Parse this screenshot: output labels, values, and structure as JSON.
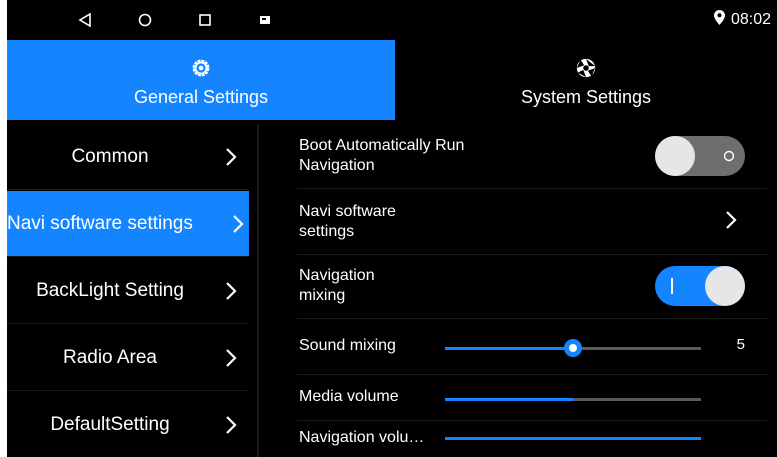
{
  "status_bar": {
    "icons": [
      "back-icon",
      "home-icon",
      "recents-icon",
      "screenshot-icon"
    ],
    "location_icon": "location-pin-icon",
    "time": "08:02"
  },
  "tabs": [
    {
      "label": "General Settings",
      "icon": "gear-icon",
      "active": true
    },
    {
      "label": "System Settings",
      "icon": "aperture-icon",
      "active": false
    }
  ],
  "sidebar": {
    "items": [
      {
        "label": "Common",
        "active": false
      },
      {
        "label": "Navi software settings",
        "active": true
      },
      {
        "label": "BackLight Setting",
        "active": false
      },
      {
        "label": "Radio Area",
        "active": false
      },
      {
        "label": "DefaultSetting",
        "active": false
      }
    ]
  },
  "settings": {
    "boot_auto_run": {
      "label_line1": "Boot Automatically Run",
      "label_line2": "Navigation",
      "state": false
    },
    "navi_software": {
      "label_line1": "Navi software",
      "label_line2": "settings"
    },
    "navigation_mixing": {
      "label_line1": "Navigation",
      "label_line2": "mixing",
      "state": true
    },
    "sound_mixing": {
      "label": "Sound mixing",
      "value": "5",
      "fraction": 0.5
    },
    "media_volume": {
      "label": "Media volume",
      "fraction": 0.5
    },
    "navigation_volume": {
      "label": "Navigation volu…",
      "fraction": 1.0
    }
  },
  "colors": {
    "accent": "#1485ff",
    "background": "#000000",
    "toggle_off": "#6e6e6e"
  }
}
